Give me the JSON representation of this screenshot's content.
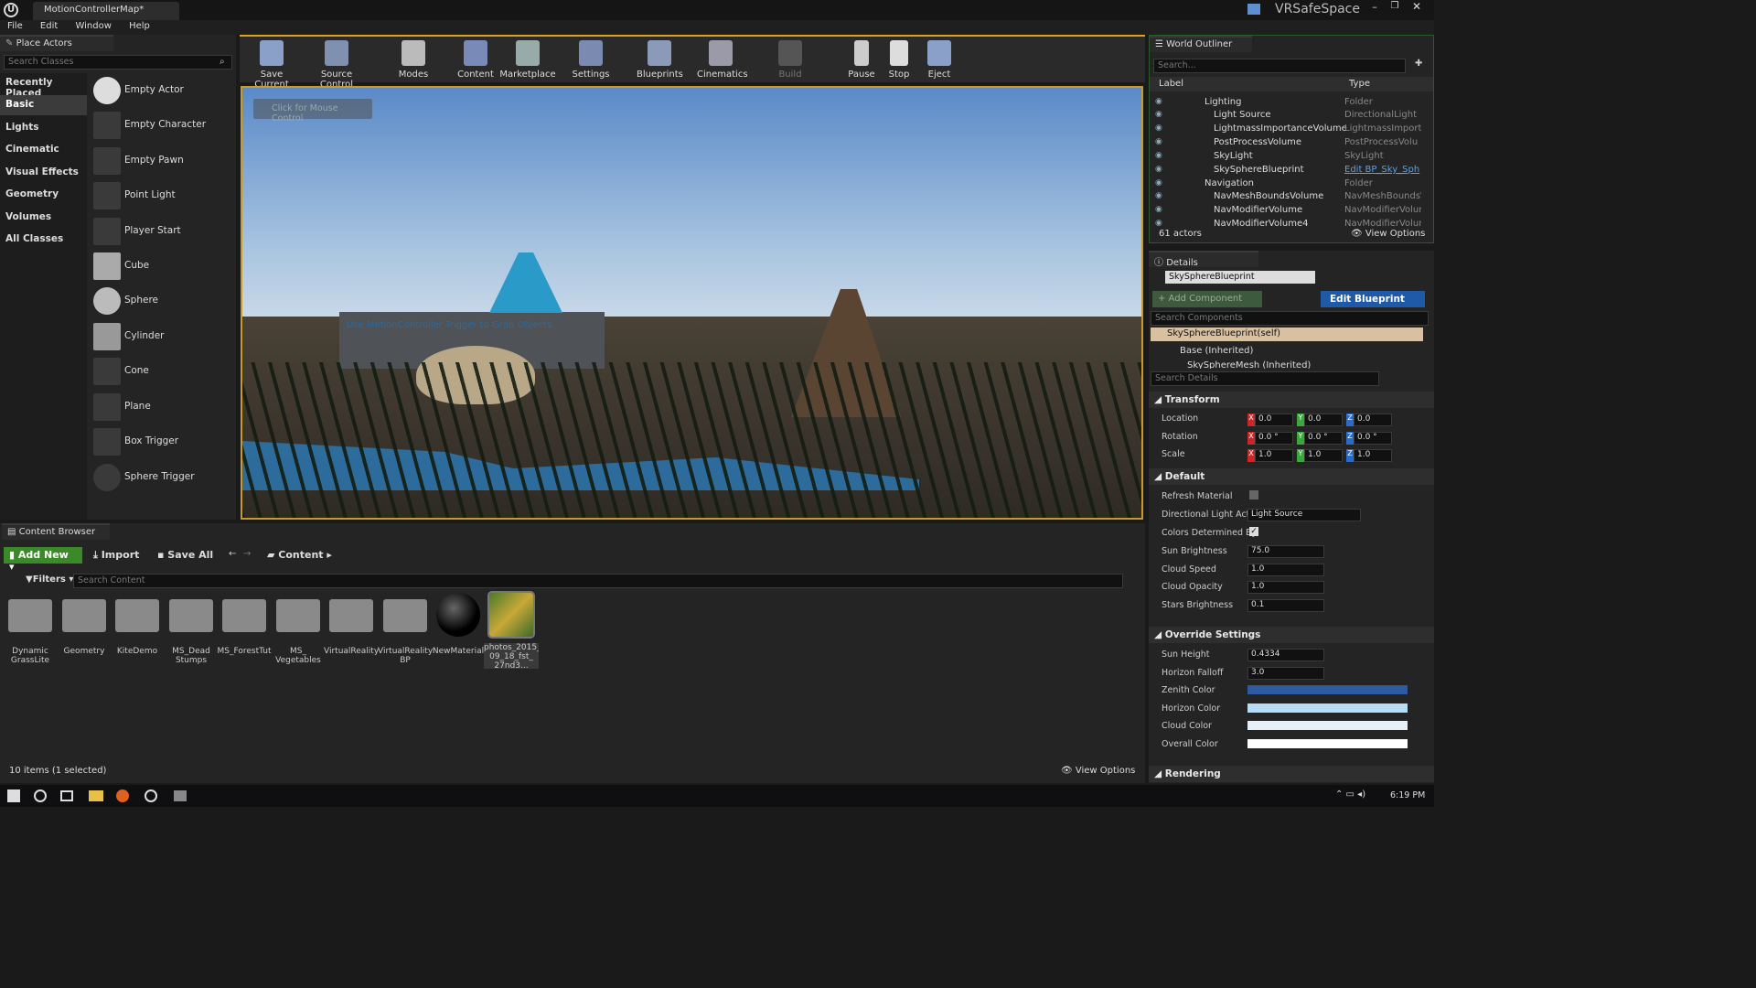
{
  "window": {
    "tab_title": "MotionControllerMap*",
    "project_name": "VRSafeSpace"
  },
  "menu": [
    "File",
    "Edit",
    "Window",
    "Help"
  ],
  "place_actors": {
    "tab": "Place Actors",
    "search_placeholder": "Search Classes",
    "categories": [
      "Recently Placed",
      "Basic",
      "Lights",
      "Cinematic",
      "Visual Effects",
      "Geometry",
      "Volumes",
      "All Classes"
    ],
    "actors": [
      "Empty Actor",
      "Empty Character",
      "Empty Pawn",
      "Point Light",
      "Player Start",
      "Cube",
      "Sphere",
      "Cylinder",
      "Cone",
      "Plane",
      "Box Trigger",
      "Sphere Trigger"
    ]
  },
  "toolbar": {
    "buttons": [
      "Save Current",
      "Source Control",
      "Modes",
      "Content",
      "Marketplace",
      "Settings",
      "Blueprints",
      "Cinematics",
      "Build",
      "Pause",
      "Stop",
      "Eject"
    ]
  },
  "viewport": {
    "mouse_hint": "Click for Mouse Control",
    "wall_text": "Use MotionController Trigger to Grab Objects"
  },
  "outliner": {
    "tab": "World Outliner",
    "search_placeholder": "Search...",
    "col_label": "Label",
    "col_type": "Type",
    "rows": [
      {
        "label": "Lighting",
        "type": "Folder"
      },
      {
        "label": "Light Source",
        "type": "DirectionalLight"
      },
      {
        "label": "LightmassImportanceVolume",
        "type": "LightmassImporta"
      },
      {
        "label": "PostProcessVolume",
        "type": "PostProcessVolu"
      },
      {
        "label": "SkyLight",
        "type": "SkyLight"
      },
      {
        "label": "SkySphereBlueprint",
        "type": "Edit BP_Sky_Sph"
      },
      {
        "label": "Navigation",
        "type": "Folder"
      },
      {
        "label": "NavMeshBoundsVolume",
        "type": "NavMeshBounds\\"
      },
      {
        "label": "NavModifierVolume",
        "type": "NavModifierVolun"
      },
      {
        "label": "NavModifierVolume4",
        "type": "NavModifierVolun"
      }
    ],
    "actor_count": "61 actors",
    "view_options": "View Options"
  },
  "details": {
    "tab": "Details",
    "object_name": "SkySphereBlueprint",
    "add_component": "+ Add Component",
    "edit_blueprint": "Edit Blueprint",
    "search_components_placeholder": "Search Components",
    "component_self": "SkySphereBlueprint(self)",
    "base_inherited": "Base (Inherited)",
    "sky_sphere_mesh": "SkySphereMesh (Inherited)",
    "search_details_placeholder": "Search Details",
    "transform": {
      "title": "Transform",
      "location_label": "Location",
      "rotation_label": "Rotation",
      "scale_label": "Scale",
      "location": [
        "0.0",
        "0.0",
        "0.0"
      ],
      "rotation": [
        "0.0 °",
        "0.0 °",
        "0.0 °"
      ],
      "scale": [
        "1.0",
        "1.0",
        "1.0"
      ]
    },
    "default": {
      "title": "Default",
      "refresh_material": "Refresh Material",
      "dir_light_actor_label": "Directional Light Actor",
      "dir_light_actor_value": "Light Source",
      "colors_determined_by": "Colors Determined By",
      "sun_brightness_label": "Sun Brightness",
      "sun_brightness": "75.0",
      "cloud_speed_label": "Cloud Speed",
      "cloud_speed": "1.0",
      "cloud_opacity_label": "Cloud Opacity",
      "cloud_opacity": "1.0",
      "stars_brightness_label": "Stars Brightness",
      "stars_brightness": "0.1"
    },
    "override": {
      "title": "Override Settings",
      "sun_height_label": "Sun Height",
      "sun_height": "0.4334",
      "horizon_falloff_label": "Horizon Falloff",
      "horizon_falloff": "3.0",
      "zenith_color_label": "Zenith Color",
      "horizon_color_label": "Horizon Color",
      "cloud_color_label": "Cloud Color",
      "overall_color_label": "Overall Color",
      "zenith_color": "#2e5aa0",
      "horizon_color": "#b8dcf4",
      "cloud_color": "#e6f0f8",
      "overall_color": "#ffffff"
    },
    "rendering": "Rendering"
  },
  "content_browser": {
    "tab": "Content Browser",
    "add_new": "Add New",
    "import": "Import",
    "save_all": "Save All",
    "path": "Content",
    "filters": "Filters",
    "search_placeholder": "Search Content",
    "items": [
      "Dynamic GrassLite",
      "Geometry",
      "KiteDemo",
      "MS_Dead Stumps",
      "MS_ForestTut",
      "MS_ Vegetables",
      "VirtualReality",
      "VirtualReality BP",
      "NewMaterial",
      "photos_2015_ 09_18_fst_ 27nd3..."
    ],
    "status": "10 items (1 selected)",
    "view_options": "View Options"
  },
  "taskbar": {
    "time": "6:19 PM"
  }
}
